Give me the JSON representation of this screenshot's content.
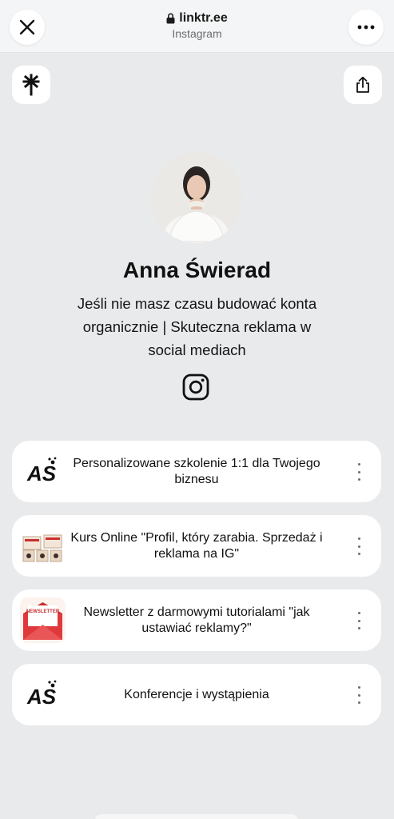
{
  "browser": {
    "url": "linktr.ee",
    "subtitle": "Instagram",
    "close_icon": "close-icon",
    "more_icon": "more-horizontal-icon",
    "lock_icon": "lock-icon"
  },
  "profile": {
    "name": "Anna Świerad",
    "bio": "Jeśli nie masz czasu budować konta organicznie | Skuteczna reklama w social mediach",
    "social_icon": "instagram-icon"
  },
  "header_buttons": {
    "left_icon": "linktree-logo-icon",
    "right_icon": "share-icon"
  },
  "links": [
    {
      "label": "Personalizowane szkolenie 1:1 dla Twojego biznesu",
      "thumb": "as-logo"
    },
    {
      "label": "Kurs Online \"Profil, który zarabia. Sprzedaż i reklama na IG\"",
      "thumb": "course-mockup"
    },
    {
      "label": "Newsletter z darmowymi tutorialami \"jak ustawiać reklamy?\"",
      "thumb": "newsletter-envelope",
      "thumb_text": "NEWSLETTER"
    },
    {
      "label": "Konferencje i wystąpienia",
      "thumb": "as-logo"
    }
  ],
  "thumb_logo_text": "AS",
  "colors": {
    "page_bg": "#e9eaec",
    "card_bg": "#ffffff",
    "text": "#111111",
    "newsletter_red": "#e0393b"
  }
}
